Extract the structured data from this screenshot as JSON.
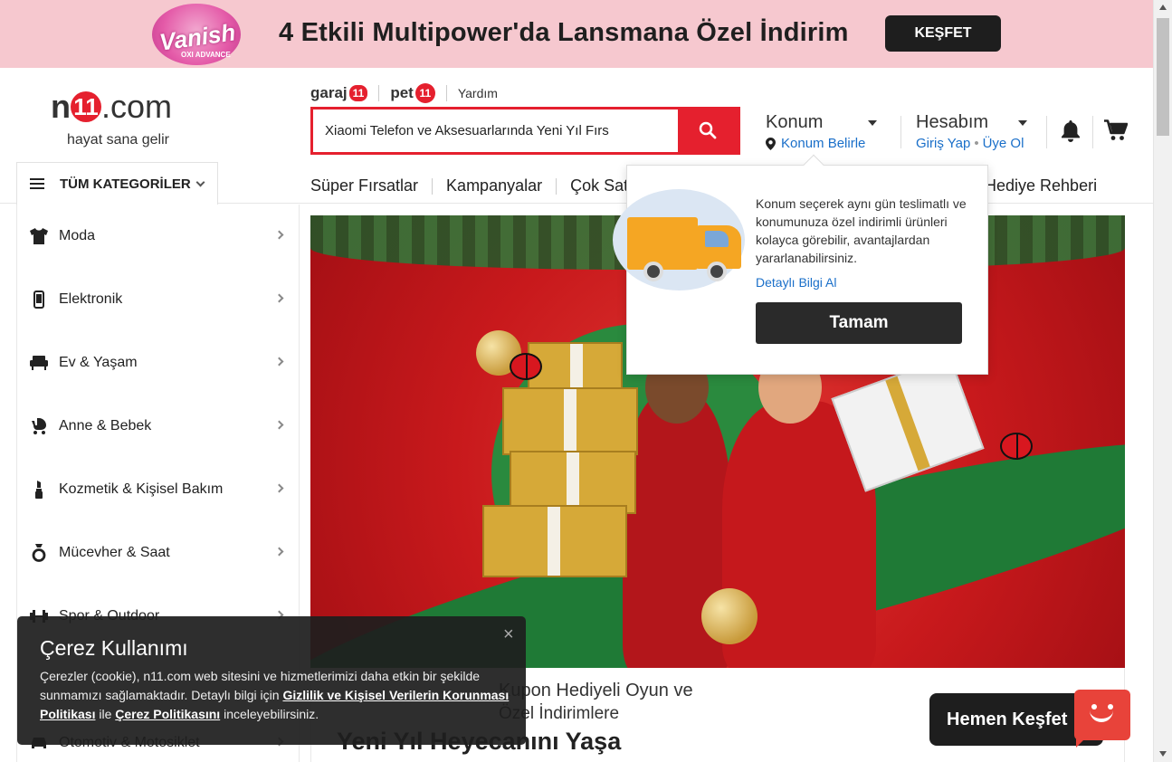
{
  "promo": {
    "brand": "Vanish",
    "brand_sub": "OXI ADVANCE",
    "text": "4 Etkili Multipower'da Lansmana Özel İndirim",
    "button": "KEŞFET"
  },
  "header": {
    "logo_n": "n",
    "logo_11": "11",
    "logo_com": ".com",
    "tagline": "hayat sana gelir",
    "sublinks": {
      "garaj": "garaj",
      "garaj_badge": "11",
      "pet": "pet",
      "pet_badge": "11",
      "help": "Yardım"
    },
    "search": {
      "value": "Xiaomi Telefon ve Aksesuarlarında Yeni Yıl Fırs"
    },
    "location": {
      "title": "Konum",
      "action": "Konum Belirle"
    },
    "account": {
      "title": "Hesabım",
      "login": "Giriş Yap",
      "dot": "•",
      "signup": "Üye Ol"
    },
    "all_categories": "TÜM KATEGORİLER",
    "nav": [
      "Süper Fırsatlar",
      "Kampanyalar",
      "Çok Satanlar"
    ],
    "nav_right": "Hediye Rehberi"
  },
  "sidebar": {
    "items": [
      {
        "label": "Moda",
        "icon": "shirt-icon"
      },
      {
        "label": "Elektronik",
        "icon": "phone-icon"
      },
      {
        "label": "Ev & Yaşam",
        "icon": "sofa-icon"
      },
      {
        "label": "Anne & Bebek",
        "icon": "stroller-icon"
      },
      {
        "label": "Kozmetik & Kişisel Bakım",
        "icon": "lipstick-icon"
      },
      {
        "label": "Mücevher & Saat",
        "icon": "ring-icon"
      },
      {
        "label": "Spor & Outdoor",
        "icon": "dumbbell-icon"
      },
      {
        "label": "Otomotiv & Motosiklet",
        "icon": "car-icon"
      }
    ]
  },
  "main": {
    "below_line1": "Kupon Hediyeli Oyun ve",
    "below_line2": "Özel İndirimlere",
    "heading": "Yeni Yıl Heyecanını Yaşa"
  },
  "popover": {
    "text": "Konum seçerek aynı gün teslimatlı ve konumunuza özel indirimli ürünleri kolayca görebilir, avantajlardan yararlanabilirsiniz.",
    "link": "Detaylı Bilgi Al",
    "button": "Tamam"
  },
  "cookie": {
    "title": "Çerez Kullanımı",
    "text_before": "Çerezler (cookie), n11.com web sitesini ve hizmetlerimizi daha etkin bir şekilde sunmamızı sağlamaktadır. Detaylı bilgi için ",
    "link1": "Gizlilik ve Kişisel Verilerin Korunması Politikası",
    "text_mid": " ile ",
    "link2": "Çerez Politikasını",
    "text_after": " inceleyebilirsiniz.",
    "close": "×"
  },
  "chat": {
    "label": "Hemen Keşfet"
  },
  "colors": {
    "brand_red": "#e5202e",
    "link_blue": "#1a6fc9",
    "promo_bg": "#f6c8cf",
    "dark": "#1e1e1e"
  }
}
